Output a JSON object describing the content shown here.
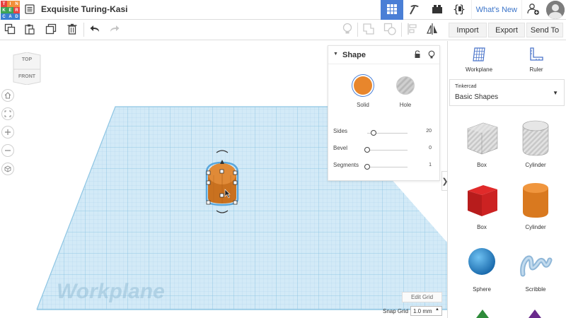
{
  "app": {
    "logo_letters": [
      "T",
      "I",
      "N",
      "K",
      "E",
      "R",
      "C",
      "A",
      "D"
    ],
    "logo_colors": [
      "#e8433f",
      "#f2903a",
      "#f2903a",
      "#3ea454",
      "#3ea454",
      "#e8433f",
      "#3b7fd1",
      "#3b7fd1",
      "#3b7fd1"
    ],
    "title": "Exquisite Turing-Kasi",
    "whats_new": "What's New",
    "accent": "#4a7fd6"
  },
  "toolbar": {
    "import_label": "Import",
    "export_label": "Export",
    "send_label": "Send To"
  },
  "viewcube": {
    "top": "TOP",
    "front": "FRONT"
  },
  "viewport": {
    "workplane_label": "Workplane",
    "edit_grid": "Edit Grid",
    "snap_grid_label": "Snap Grid",
    "snap_grid_value": "1.0 mm"
  },
  "shape_panel": {
    "title": "Shape",
    "solid_label": "Solid",
    "hole_label": "Hole",
    "solid_color": "#e8862c",
    "props": [
      {
        "label": "Sides",
        "value": "20",
        "level": 0.15
      },
      {
        "label": "Bevel",
        "value": "0",
        "level": 0
      },
      {
        "label": "Segments",
        "value": "1",
        "level": 0
      }
    ]
  },
  "right_panel": {
    "workplane_label": "Workplane",
    "ruler_label": "Ruler",
    "library_group": "Tinkercad",
    "library_name": "Basic Shapes",
    "shapes": [
      {
        "label": "Box",
        "icon": "box-hole-icon"
      },
      {
        "label": "Cylinder",
        "icon": "cylinder-hole-icon"
      },
      {
        "label": "Box",
        "icon": "box-icon"
      },
      {
        "label": "Cylinder",
        "icon": "cylinder-icon"
      },
      {
        "label": "Sphere",
        "icon": "sphere-icon"
      },
      {
        "label": "Scribble",
        "icon": "scribble-icon"
      }
    ]
  }
}
